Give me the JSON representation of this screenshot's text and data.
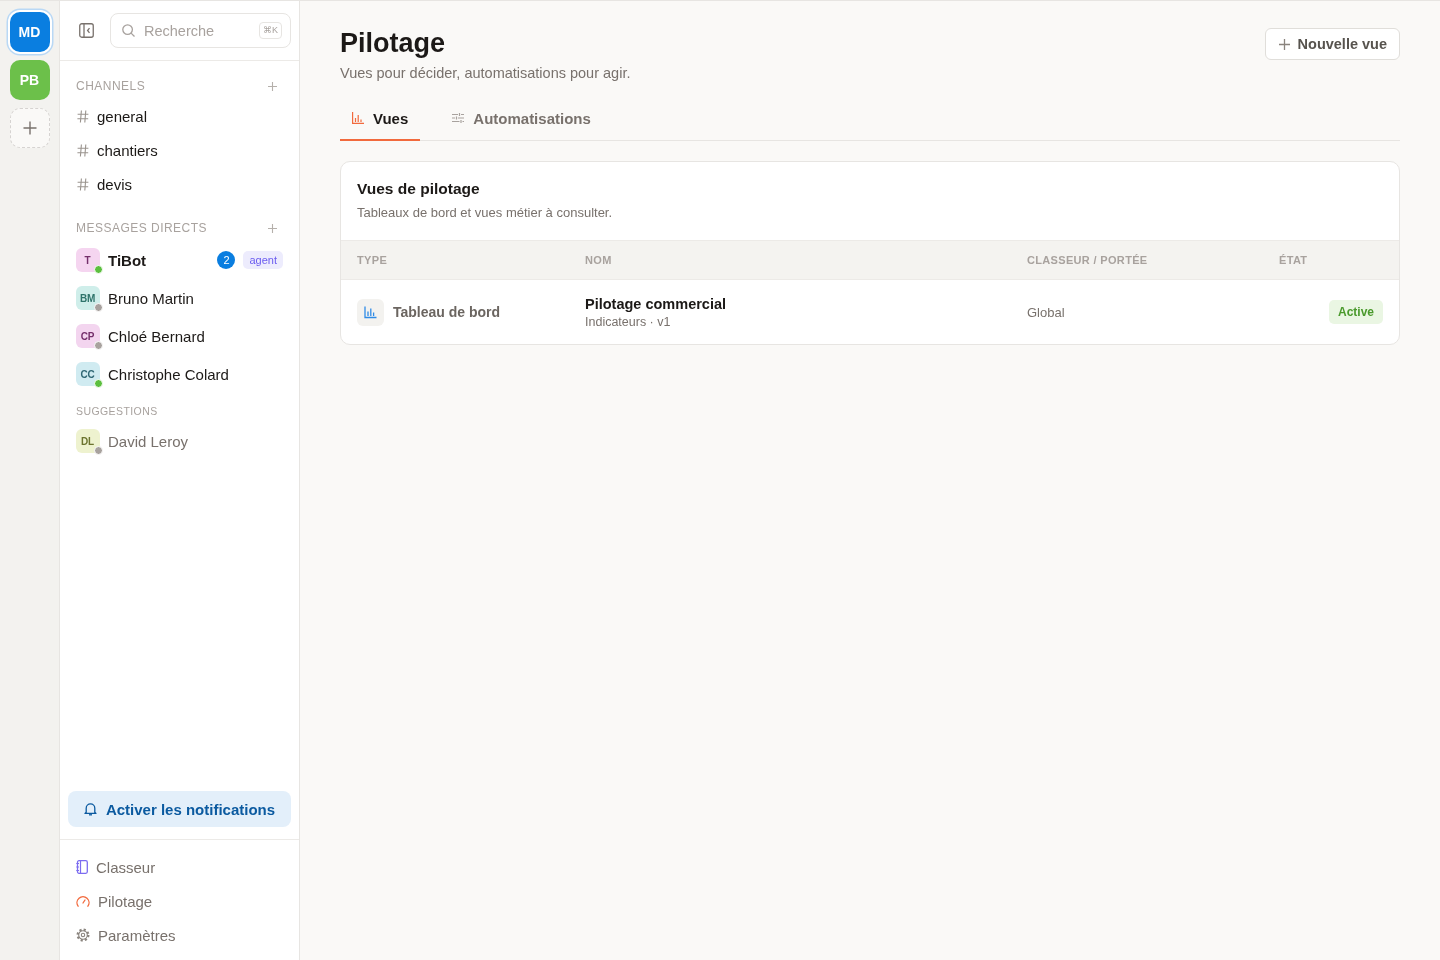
{
  "workspaces": [
    {
      "initials": "MD",
      "color": "#0a7ee0",
      "selected": true
    },
    {
      "initials": "PB",
      "color": "#6cc04a",
      "selected": false
    }
  ],
  "search": {
    "placeholder": "Recherche",
    "shortcut": "⌘K"
  },
  "channels": {
    "title": "CHANNELS",
    "items": [
      "general",
      "chantiers",
      "devis"
    ]
  },
  "direct_messages": {
    "title": "MESSAGES DIRECTS",
    "items": [
      {
        "initials": "T",
        "name": "TiBot",
        "color": "#f5d5f0",
        "online": true,
        "unread": true,
        "badge": "2",
        "tag": "agent"
      },
      {
        "initials": "BM",
        "name": "Bruno Martin",
        "color": "#cfeeea",
        "online": false,
        "unread": false
      },
      {
        "initials": "CP",
        "name": "Chloé Bernard",
        "color": "#f3d5ef",
        "online": false,
        "unread": false
      },
      {
        "initials": "CC",
        "name": "Christophe Colard",
        "color": "#d0ebf1",
        "online": true,
        "unread": false
      }
    ]
  },
  "suggestions": {
    "title": "SUGGESTIONS",
    "items": [
      {
        "initials": "DL",
        "name": "David Leroy",
        "color": "#eef2cf",
        "online": false
      }
    ]
  },
  "notifications_button": "Activer les notifications",
  "nav": [
    "Classeur",
    "Pilotage",
    "Paramètres"
  ],
  "page": {
    "title": "Pilotage",
    "subtitle": "Vues pour décider, automatisations pour agir.",
    "action": "Nouvelle vue"
  },
  "tabs": [
    {
      "label": "Vues",
      "selected": true
    },
    {
      "label": "Automatisations",
      "selected": false
    }
  ],
  "card": {
    "title": "Vues de pilotage",
    "description": "Tableaux de bord et vues métier à consulter.",
    "table": {
      "columns": [
        "TYPE",
        "NOM",
        "CLASSEUR / PORTÉE",
        "ÉTAT"
      ],
      "rows": [
        {
          "type": "Tableau de bord",
          "name": "Pilotage commercial",
          "meta": "Indicateurs · v1",
          "scope": "Global",
          "status": "Active"
        }
      ]
    }
  }
}
